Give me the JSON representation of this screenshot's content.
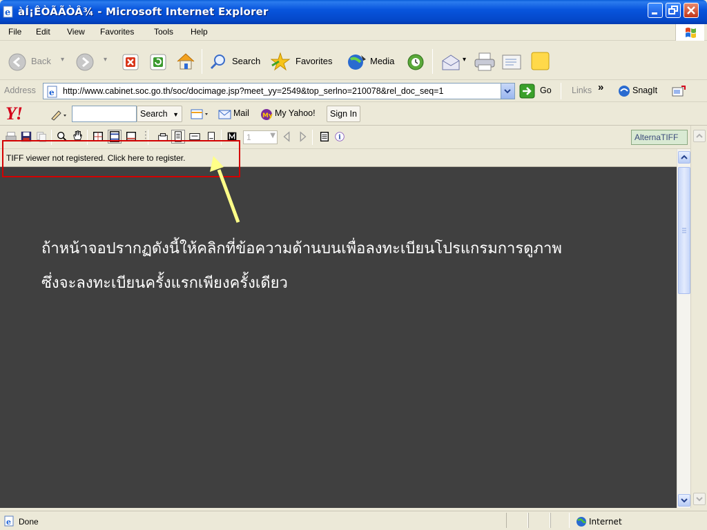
{
  "window": {
    "title": "àÍ¡ÊÒÃÃÒÂ¾ - Microsoft Internet Explorer"
  },
  "menu": {
    "items": [
      "File",
      "Edit",
      "View",
      "Favorites",
      "Tools",
      "Help"
    ]
  },
  "toolbar": {
    "back_label": "Back",
    "search_label": "Search",
    "favorites_label": "Favorites",
    "media_label": "Media"
  },
  "address": {
    "label": "Address",
    "url": "http://www.cabinet.soc.go.th/soc/docimage.jsp?meet_yy=2549&top_serlno=210078&rel_doc_seq=1",
    "go_label": "Go",
    "links_label": "Links",
    "chevron": "»",
    "snagit_label": "SnagIt"
  },
  "yahoo": {
    "logo": "Y!",
    "search_value": "",
    "search_label": "Search",
    "mail_label": "Mail",
    "my_yahoo_label": "My Yahoo!",
    "sign_in_label": "Sign In"
  },
  "tiff": {
    "page_value": "1",
    "brand_label": "AlternaTIFF",
    "register_message": "TIFF viewer not registered. Click here to register."
  },
  "annotation": {
    "line1": "ถ้าหน้าจอปรากฏดังนี้ให้คลิกที่ข้อความด้านบนเพื่อลงทะเบียนโปรแกรมการดูภาพ",
    "line2": "ซึ่งจะลงทะเบียนครั้งแรกเพียงครั้งเดียว",
    "arrow_color": "#ffff88",
    "highlight_color": "#d40000"
  },
  "status": {
    "text": "Done",
    "zone": "Internet"
  },
  "colors": {
    "titlebar": "#0855dd",
    "chrome": "#ece9d8",
    "content_bg": "#404040"
  }
}
